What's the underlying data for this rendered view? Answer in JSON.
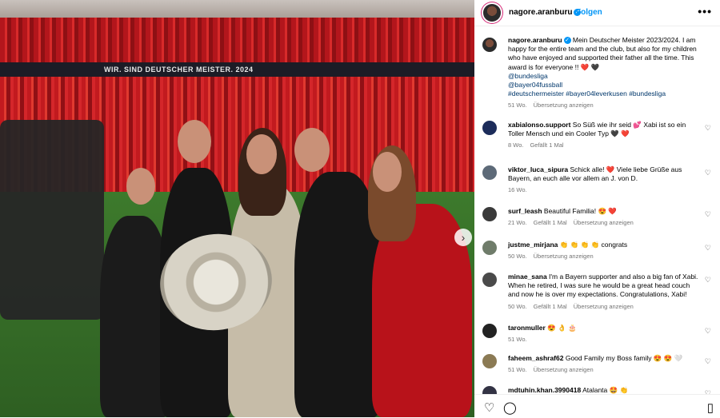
{
  "post": {
    "username": "nagore.aranburu",
    "follow_label": "Folgen",
    "more_label": "•••",
    "caption_text": "Mein Deutscher Meister 2023/2024. I am happy for the entire team and the club, but also for my children who have enjoyed and supported their father all the time. This award is for everyone !! ❤️ 🖤",
    "caption_tags": [
      "@bundesliga",
      "@bayer04fussball",
      "#deutschermeister #bayer04leverkusen #bundesliga"
    ],
    "caption_age": "51 Wo.",
    "caption_translate": "Übersetzung anzeigen",
    "photo_banner": "WIR. SIND DEUTSCHER MEISTER. 2024"
  },
  "comments": [
    {
      "user": "xabialonso.support",
      "text": "So Süß wie ihr seid 💕 Xabi ist so ein Toller Mensch und ein Cooler Typ 🖤 ❤️",
      "age": "8 Wo.",
      "likes": "Gefällt 1 Mal",
      "translate": ""
    },
    {
      "user": "viktor_luca_sipura",
      "text": "Schick alle! ❤️ Viele liebe Grüße aus Bayern, an euch alle vor allem an J. von D.",
      "age": "16 Wo.",
      "likes": "",
      "translate": ""
    },
    {
      "user": "surf_leash",
      "text": "Beautiful Familia! 😍 ❤️",
      "age": "21 Wo.",
      "likes": "Gefällt 1 Mal",
      "translate": "Übersetzung anzeigen"
    },
    {
      "user": "justme_mirjana",
      "text": "👏 👏 👏 👏 congrats",
      "age": "50 Wo.",
      "likes": "",
      "translate": "Übersetzung anzeigen"
    },
    {
      "user": "minae_sana",
      "text": "I'm a Bayern supporter and also a big fan of Xabi. When he retired, I was sure he would be a great head couch and now he is over my expectations. Congratulations, Xabi!",
      "age": "50 Wo.",
      "likes": "Gefällt 1 Mal",
      "translate": "Übersetzung anzeigen"
    },
    {
      "user": "taronmuller",
      "text": "😍 👌 🎂",
      "age": "51 Wo.",
      "likes": "",
      "translate": ""
    },
    {
      "user": "faheem_ashraf62",
      "text": "Good Family my Boss family 😍 😍 🤍",
      "age": "51 Wo.",
      "likes": "",
      "translate": "Übersetzung anzeigen"
    },
    {
      "user": "mdtuhin.khan.3990418",
      "text": "Atalanta 🤩 👏",
      "age": "",
      "likes": "",
      "translate": ""
    }
  ],
  "icons": {
    "like": "heart-icon",
    "comment": "comment-icon",
    "save": "bookmark-icon",
    "next": "chevron-right-icon"
  },
  "colors": {
    "link": "#00376b",
    "follow": "#0095f6",
    "muted": "#737373"
  }
}
